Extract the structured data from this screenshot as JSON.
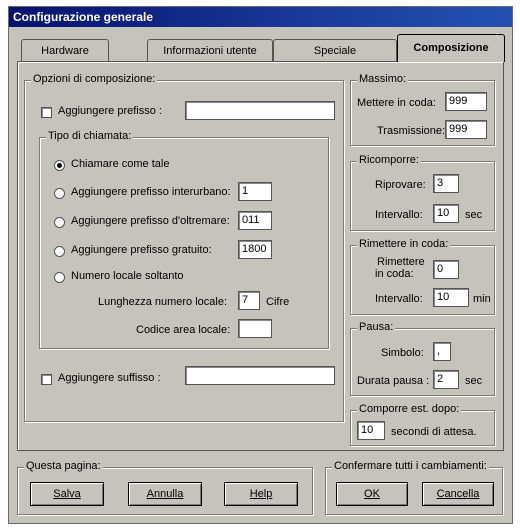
{
  "window": {
    "title": "Configurazione generale"
  },
  "tabs": [
    {
      "label": "Hardware",
      "active": false
    },
    {
      "label": "Informazioni utente",
      "active": false
    },
    {
      "label": "Speciale",
      "active": false
    },
    {
      "label": "Composizione",
      "active": true
    }
  ],
  "composition": {
    "legend": "Opzioni di composizione:",
    "prefix": {
      "label": "Aggiungere prefisso :",
      "checked": false,
      "value": ""
    },
    "call_type": {
      "legend": "Tipo di chiamata:",
      "options": [
        {
          "label": "Chiamare come tale",
          "selected": true
        },
        {
          "label": "Aggiungere prefisso interurbano:",
          "value": "1",
          "selected": false
        },
        {
          "label": "Aggiungere prefisso d'oltremare:",
          "value": "011",
          "selected": false
        },
        {
          "label": "Aggiungere prefisso gratuito:",
          "value": "1800",
          "selected": false
        },
        {
          "label": "Numero locale soltanto",
          "selected": false
        }
      ],
      "local_length": {
        "label": "Lunghezza numero locale:",
        "value": "7",
        "unit": "Cifre"
      },
      "area_code": {
        "label": "Codice area locale:",
        "value": ""
      }
    },
    "suffix": {
      "label": "Aggiungere suffisso :",
      "checked": false,
      "value": ""
    }
  },
  "massimo": {
    "legend": "Massimo:",
    "queue": {
      "label": "Mettere in coda:",
      "value": "999"
    },
    "transmission": {
      "label": "Trasmissione:",
      "value": "999"
    }
  },
  "ricomporre": {
    "legend": "Ricomporre:",
    "retry": {
      "label": "Riprovare:",
      "value": "3"
    },
    "interval": {
      "label": "Intervallo:",
      "value": "10",
      "unit": "sec"
    }
  },
  "rimettere": {
    "legend": "Rimettere in coda:",
    "requeue": {
      "label_line1": "Rimettere",
      "label_line2": "in coda:",
      "value": "0"
    },
    "interval": {
      "label": "Intervallo:",
      "value": "10",
      "unit": "min"
    }
  },
  "pausa": {
    "legend": "Pausa:",
    "symbol": {
      "label": "Simbolo:",
      "value": ","
    },
    "duration": {
      "label": "Durata pausa :",
      "value": "2",
      "unit": "sec"
    }
  },
  "comporre_dopo": {
    "legend": "Comporre est. dopo:",
    "value": "10",
    "unit": "secondi di attesa."
  },
  "this_page": {
    "legend": "Questa pagina:",
    "save": "Salva",
    "cancel": "Annulla",
    "help": "Help"
  },
  "confirm_all": {
    "legend": "Confermare tutti i cambiamenti:",
    "ok": "OK",
    "cancel": "Cancella"
  }
}
